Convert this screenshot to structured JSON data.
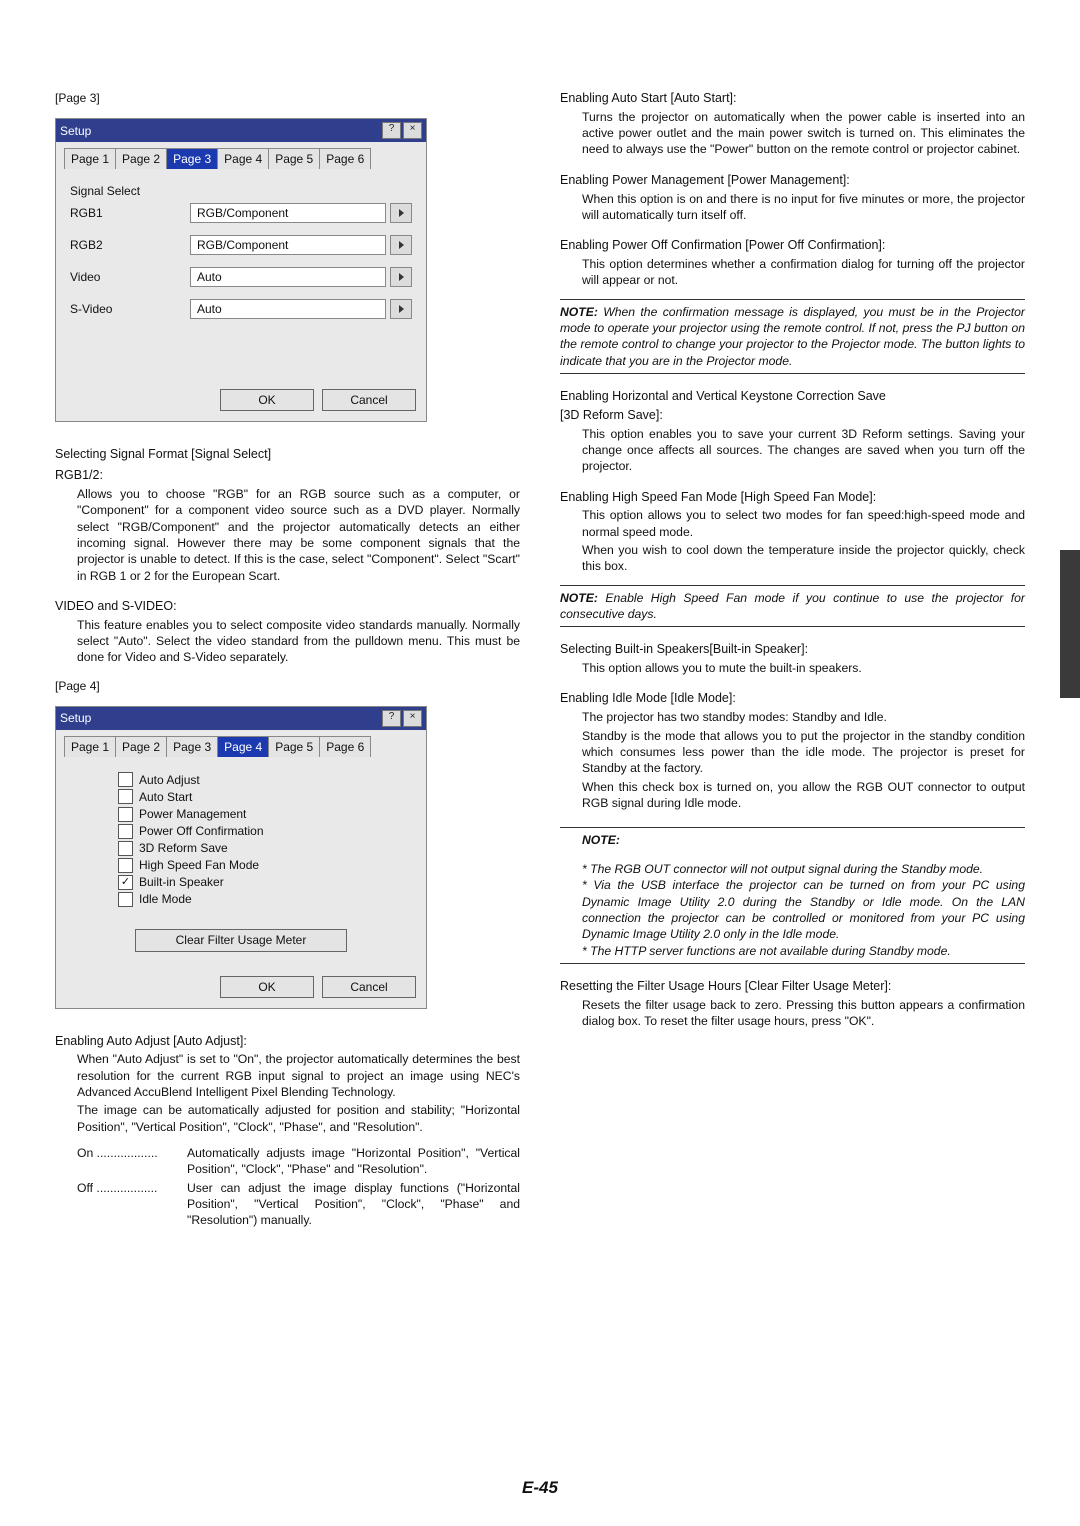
{
  "page_label_3": "[Page 3]",
  "page_label_4": "[Page 4]",
  "footer": "E-45",
  "dlg3": {
    "title": "Setup",
    "tabs": [
      "Page 1",
      "Page 2",
      "Page 3",
      "Page 4",
      "Page 5",
      "Page 6"
    ],
    "selected_tab_idx": 2,
    "signal_select_label": "Signal Select",
    "rows": [
      {
        "label": "RGB1",
        "value": "RGB/Component"
      },
      {
        "label": "RGB2",
        "value": "RGB/Component"
      },
      {
        "label": "Video",
        "value": "Auto"
      },
      {
        "label": "S-Video",
        "value": "Auto"
      }
    ],
    "ok": "OK",
    "cancel": "Cancel"
  },
  "dlg4": {
    "title": "Setup",
    "tabs": [
      "Page 1",
      "Page 2",
      "Page 3",
      "Page 4",
      "Page 5",
      "Page 6"
    ],
    "selected_tab_idx": 3,
    "checks": [
      {
        "label": "Auto Adjust",
        "checked": false
      },
      {
        "label": "Auto Start",
        "checked": false
      },
      {
        "label": "Power Management",
        "checked": false
      },
      {
        "label": "Power Off Confirmation",
        "checked": false
      },
      {
        "label": "3D Reform Save",
        "checked": false
      },
      {
        "label": "High Speed Fan Mode",
        "checked": false
      },
      {
        "label": "Built-in Speaker",
        "checked": true
      },
      {
        "label": "Idle Mode",
        "checked": false
      }
    ],
    "clear_filter": "Clear Filter Usage Meter",
    "ok": "OK",
    "cancel": "Cancel"
  },
  "left": {
    "h_signal_select": "Selecting Signal Format [Signal Select]",
    "h_rgb12": "RGB1/2:",
    "p_rgb12": "Allows you to choose \"RGB\" for an RGB source such as a computer, or \"Component\" for a component video source such as a DVD player. Normally select \"RGB/Component\" and the projector automatically detects an either incoming signal. However there may be some component signals that the projector is unable to detect. If this is the case, select \"Component\". Select \"Scart\" in RGB 1 or 2 for the European Scart.",
    "h_video": "VIDEO and S-VIDEO:",
    "p_video": "This feature enables you to select composite video standards manually. Normally select \"Auto\". Select the video standard from the pulldown menu. This must be done for Video and S-Video separately.",
    "h_autoadj": "Enabling Auto Adjust [Auto Adjust]:",
    "p_autoadj1": "When \"Auto Adjust\" is set to \"On\", the projector automatically determines the best resolution for the current RGB input signal to project an image using NEC's Advanced AccuBlend Intelligent Pixel Blending Technology.",
    "p_autoadj2": "The image can be automatically adjusted for position and stability; \"Horizontal Position\", \"Vertical Position\", \"Clock\", \"Phase\", and \"Resolution\".",
    "on_term": "On",
    "on_desc": "Automatically adjusts image \"Horizontal Position\", \"Vertical Position\", \"Clock\", \"Phase\" and \"Resolution\".",
    "off_term": "Off",
    "off_desc": "User can adjust the image display functions (\"Horizontal Position\", \"Vertical Position\", \"Clock\", \"Phase\" and \"Resolution\") manually."
  },
  "right": {
    "h_autostart": "Enabling Auto Start [Auto Start]:",
    "p_autostart": "Turns the projector on automatically when the power cable is inserted into an active power outlet and the main power switch is turned on. This eliminates the need to always use the \"Power\" button on the remote control or projector cabinet.",
    "h_powermgmt": "Enabling Power Management [Power Management]:",
    "p_powermgmt": "When this option is on and there is no input for five minutes or more, the projector will automatically turn itself off.",
    "h_poweroffconf": "Enabling Power Off Confirmation [Power Off Confirmation]:",
    "p_poweroffconf": "This option determines whether a confirmation dialog for turning off the projector will appear or not.",
    "note1_label": "NOTE:",
    "note1": " When the confirmation message is displayed, you must be in the Projector mode to operate your projector using the remote control. If not, press the PJ button on the remote control to change your projector to the Projector mode. The button lights to indicate that you are in the Projector mode.",
    "h_3dreform1": "Enabling Horizontal and Vertical Keystone Correction Save",
    "h_3dreform2": "[3D Reform Save]:",
    "p_3dreform": "This option enables you to save your current 3D Reform settings. Saving your change once affects all sources. The changes are saved when you turn off the projector.",
    "h_fan": "Enabling High Speed Fan Mode [High Speed Fan Mode]:",
    "p_fan1": "This option allows you to select two modes for fan speed:high-speed mode and normal speed mode.",
    "p_fan2": "When you wish to cool down the temperature inside the projector quickly, check this box.",
    "note2_label": "NOTE:",
    "note2": " Enable High Speed Fan mode if you continue to use the projector for consecutive days.",
    "h_speaker": "Selecting Built-in Speakers[Built-in Speaker]:",
    "p_speaker": "This option allows you to mute the built-in speakers.",
    "h_idle": "Enabling Idle Mode [Idle Mode]:",
    "p_idle1": "The projector has two standby modes: Standby and Idle.",
    "p_idle2": "Standby is the mode that allows you to put the projector in the standby condition which consumes less power than the idle mode. The projector is preset for Standby at the factory.",
    "p_idle3": "When this check box is turned on, you allow the RGB OUT connector to output RGB signal during Idle mode.",
    "note3_head": "NOTE:",
    "note3_1": "* The RGB OUT connector will not output signal during the Standby mode.",
    "note3_2": "* Via the USB interface the projector can be turned on from your PC using Dynamic Image Utility 2.0 during the Standby or Idle mode. On the LAN connection the projector can be controlled or monitored from your PC using Dynamic Image Utility 2.0 only in the Idle mode.",
    "note3_3": "* The HTTP server functions are not available during Standby mode.",
    "h_filter": "Resetting the Filter Usage Hours [Clear Filter Usage Meter]:",
    "p_filter": "Resets the filter usage back to zero. Pressing this button appears a confirmation dialog box. To reset the filter usage hours, press \"OK\"."
  }
}
